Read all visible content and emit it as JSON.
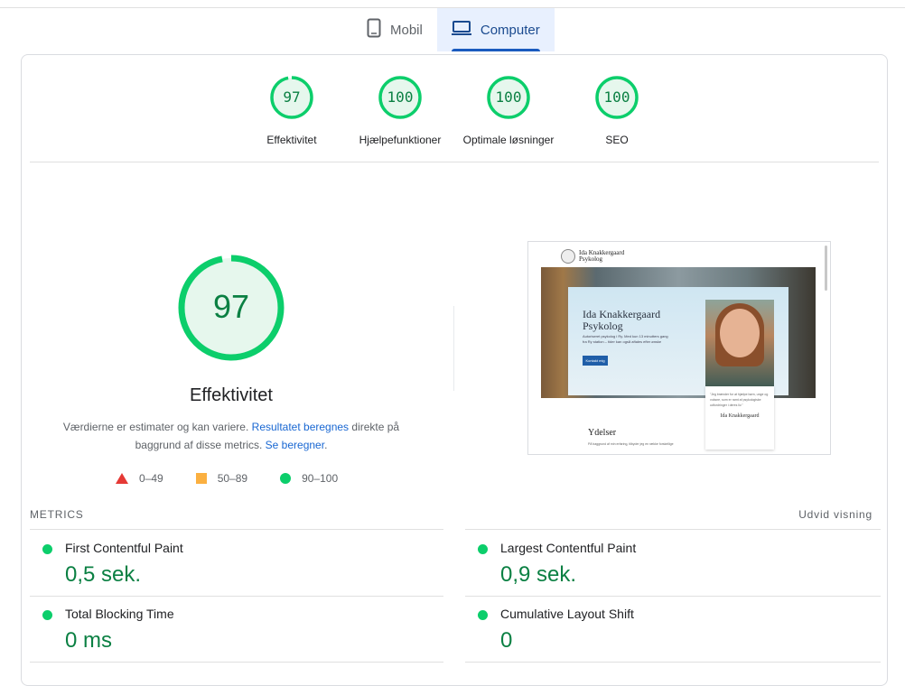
{
  "tabs": [
    {
      "label": "Mobil",
      "icon": "phone-icon",
      "active": false
    },
    {
      "label": "Computer",
      "icon": "laptop-icon",
      "active": true
    }
  ],
  "colors": {
    "pass": "#0cce6b",
    "pass_text": "#0b8043",
    "average": "#fbb040",
    "fail": "#e53935",
    "link": "#1967d2"
  },
  "summary_scores": [
    {
      "score": "97",
      "label": "Effektivitet",
      "fraction": 0.97
    },
    {
      "score": "100",
      "label": "Hjælpefunktioner",
      "fraction": 1.0
    },
    {
      "score": "100",
      "label": "Optimale løsninger",
      "fraction": 1.0
    },
    {
      "score": "100",
      "label": "SEO",
      "fraction": 1.0
    }
  ],
  "main": {
    "score": "97",
    "fraction": 0.97,
    "title": "Effektivitet",
    "desc_part1": "Værdierne er estimater og kan variere. ",
    "desc_link1": "Resultatet beregnes",
    "desc_part2": " direkte på baggrund af disse metrics. ",
    "desc_link2": "Se beregner",
    "desc_part3": "."
  },
  "legend": [
    {
      "shape": "triangle",
      "range": "0–49"
    },
    {
      "shape": "square",
      "range": "50–89"
    },
    {
      "shape": "circle",
      "range": "90–100"
    }
  ],
  "preview": {
    "logo_name": "Ida Knakkergaard",
    "logo_sub": "Psykolog",
    "hero_title_1": "Ida Knakkergaard",
    "hero_title_2": "Psykolog",
    "hero_text": "Autoriseret psykolog i Ry. Med kun 13 minutters gang fra Ry station – tider kan også aftales efter ønske",
    "button": "Kontakt mig",
    "quote": "\"Jeg brænder for at hjælpe børn, unge og voksne, som er ramt af psykologiske udfordringer i deres liv.\"",
    "signature": "Ida Knakkergaard",
    "section": "Ydelser",
    "section_sub": "På baggrund af min erfaring, tilbyder jeg en række forskellige"
  },
  "metrics": {
    "heading": "METRICS",
    "expand_label": "Udvid visning",
    "items": [
      {
        "name": "First Contentful Paint",
        "value": "0,5 sek."
      },
      {
        "name": "Largest Contentful Paint",
        "value": "0,9 sek."
      },
      {
        "name": "Total Blocking Time",
        "value": "0 ms"
      },
      {
        "name": "Cumulative Layout Shift",
        "value": "0"
      }
    ]
  }
}
